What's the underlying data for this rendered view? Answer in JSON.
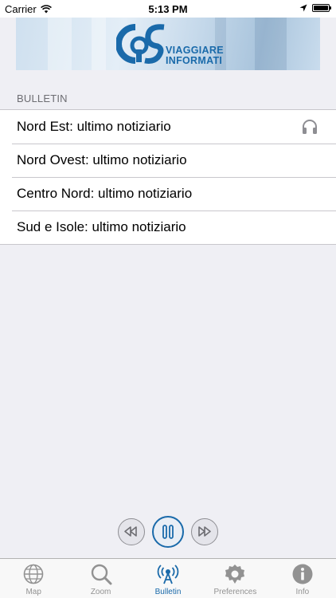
{
  "status_bar": {
    "carrier": "Carrier",
    "time": "5:13 PM"
  },
  "banner": {
    "line1": "VIAGGIARE",
    "line2": "INFORMATI"
  },
  "section": {
    "title": "BULLETIN"
  },
  "bulletins": [
    {
      "label": "Nord Est: ultimo notiziario",
      "playing": true
    },
    {
      "label": "Nord Ovest: ultimo notiziario",
      "playing": false
    },
    {
      "label": "Centro Nord: ultimo notiziario",
      "playing": false
    },
    {
      "label": "Sud e Isole: ultimo notiziario",
      "playing": false
    }
  ],
  "player": {
    "controls": [
      "rewind-icon",
      "pause-icon",
      "fast-forward-icon"
    ]
  },
  "tab_bar": {
    "active": "Bulletin",
    "tabs": [
      {
        "label": "Map",
        "icon": "globe-icon"
      },
      {
        "label": "Zoom",
        "icon": "magnifier-icon"
      },
      {
        "label": "Bulletin",
        "icon": "radio-antenna-icon"
      },
      {
        "label": "Preferences",
        "icon": "gear-icon"
      },
      {
        "label": "Info",
        "icon": "info-icon"
      }
    ]
  },
  "colors": {
    "accent": "#1a6aaa",
    "background": "#efeff4",
    "inactive_tab": "#929292",
    "separator": "#c8c7cc"
  }
}
